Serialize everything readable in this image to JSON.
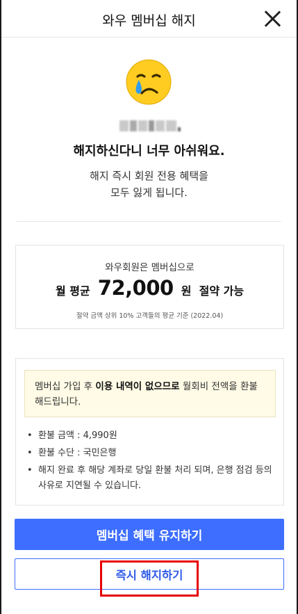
{
  "header": {
    "title": "와우 멤버십 해지"
  },
  "main": {
    "headline": "해지하신다니 너무 아쉬워요.",
    "subtext_line1": "해지 즉시 회원 전용 혜택을",
    "subtext_line2": "모두 잃게 됩니다."
  },
  "savings": {
    "line1": "와우회원은 멤버십으로",
    "prefix": "월 평균",
    "amount": "72,000",
    "unit": "원",
    "suffix": "절약 가능",
    "footnote": "절약 금액 상위 10% 고객들의 평균 기준 (2022.04)"
  },
  "refund": {
    "notice_pre": "멤버십 가입 후 ",
    "notice_bold": "이용 내역이 없으므로",
    "notice_post": " 월회비 전액을 환불해드립니다.",
    "items": [
      "환불 금액 : 4,990원",
      "환불 수단 : 국민은행",
      "해지 완료 후 해당 계좌로 당일 환불 처리 되며, 은행 점검 등의 사유로 지연될 수 있습니다."
    ]
  },
  "buttons": {
    "keep_label": "멤버십 혜택 유지하기",
    "cancel_label": "즉시 해지하기"
  },
  "colors": {
    "accent": "#3d6eff",
    "highlight": "#e60000",
    "notice_bg": "#fffbe6"
  },
  "icons": {
    "emoji": "crying-face-icon",
    "close": "close-icon"
  }
}
